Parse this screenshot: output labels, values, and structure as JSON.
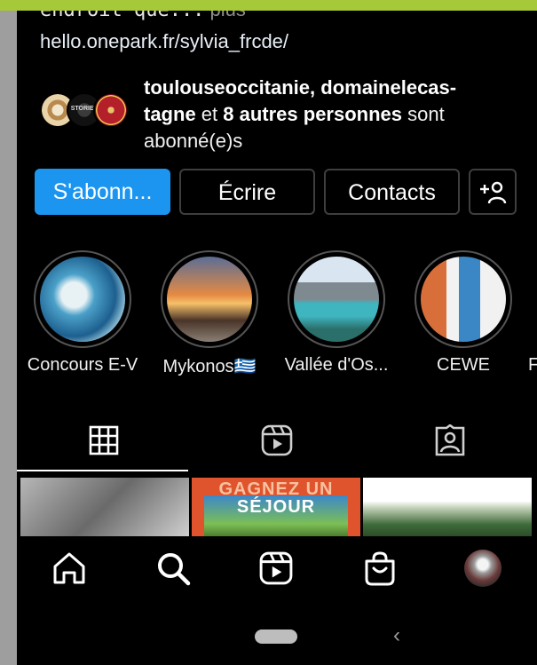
{
  "bio": {
    "cut_text": "endroit que...",
    "more": " plus",
    "link": "hello.onepark.fr/sylvia_frcde/"
  },
  "followed_by": {
    "name1": "toulouseoccitanie, domainelecas-",
    "name2": "tagne",
    "conj": " et ",
    "others": "8 autres personnes",
    "rest": " sont abonné(e)s",
    "badge_text": "STORIES"
  },
  "actions": {
    "subscribe": "S'abonn...",
    "write": "Écrire",
    "contacts": "Contacts"
  },
  "highlights": [
    {
      "label": "Concours E-V"
    },
    {
      "label": "Mykonos🇬🇷"
    },
    {
      "label": "Vallée d'Os..."
    },
    {
      "label": "CEWE"
    }
  ],
  "highlight_partial": "F",
  "posts": {
    "post2_line1": "GAGNEZ UN",
    "post2_line2": "SÉJOUR"
  },
  "colors": {
    "accent": "#1b95f0",
    "topbar": "#a6c93a",
    "background": "#000000"
  },
  "icons": [
    "grid-icon",
    "reels-icon",
    "tagged-icon",
    "home-icon",
    "search-icon",
    "shop-icon",
    "add-user-icon",
    "back-icon"
  ]
}
